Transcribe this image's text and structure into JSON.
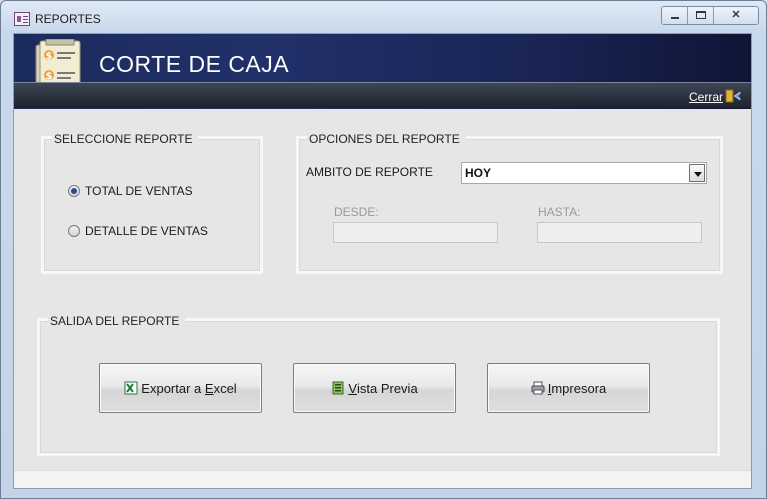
{
  "window": {
    "title": "REPORTES",
    "icons": {
      "app": "form-icon",
      "minimize": "minimize-icon",
      "maximize": "restore-icon",
      "close": "close-icon"
    },
    "close_glyph": "✕"
  },
  "header": {
    "title": "CORTE DE CAJA",
    "icon": "cash-document-icon",
    "close_link_label": "Cerrar",
    "close_link_icon": "exit-door-icon"
  },
  "report_selection": {
    "group_label": "SELECCIONE REPORTE",
    "options": [
      {
        "label": "TOTAL DE VENTAS",
        "selected": true
      },
      {
        "label": "DETALLE DE VENTAS",
        "selected": false
      }
    ]
  },
  "report_options": {
    "group_label": "OPCIONES DEL REPORTE",
    "scope_label": "AMBITO DE REPORTE",
    "scope_value": "HOY",
    "from_label": "DESDE:",
    "from_value": "",
    "to_label": "HASTA:",
    "to_value": ""
  },
  "report_output": {
    "group_label": "SALIDA DEL REPORTE",
    "buttons": [
      {
        "label_pre": "Exportar a ",
        "label_accel": "E",
        "label_post": "xcel",
        "icon": "excel-icon"
      },
      {
        "label_pre": "",
        "label_accel": "V",
        "label_post": "ista Previa",
        "icon": "preview-icon"
      },
      {
        "label_pre": "",
        "label_accel": "I",
        "label_post": "mpresora",
        "icon": "printer-icon"
      }
    ]
  },
  "colors": {
    "header_bg": "#1c2b5e",
    "selected_radio": "#2a4a9c",
    "client_bg": "#e6e6e6"
  }
}
